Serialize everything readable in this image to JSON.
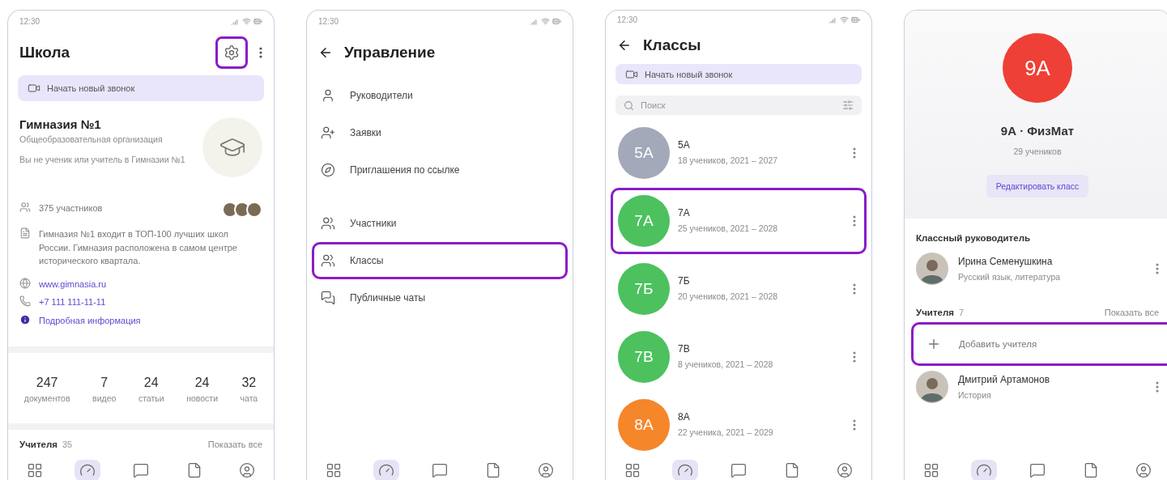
{
  "screens": [
    {
      "kind": "school",
      "status_time": "12:30",
      "title": "Школа",
      "settings_highlighted": true,
      "banner": "Начать новый звонок",
      "org": {
        "name": "Гимназия №1",
        "type": "Общеобразовательная организация",
        "note": "Вы не ученик или учитель в Гимназии №1"
      },
      "members": "375 участников",
      "description": "Гимназия №1 входит в ТОП-100 лучших школ России. Гимназия расположена в самом центре исторического квартала.",
      "website": "www.gimnasia.ru",
      "phone": "+7 111 111-11-11",
      "more": "Подробная информация",
      "stats": [
        {
          "value": "247",
          "label": "документов"
        },
        {
          "value": "7",
          "label": "видео"
        },
        {
          "value": "24",
          "label": "статьи"
        },
        {
          "value": "24",
          "label": "новости"
        },
        {
          "value": "32",
          "label": "чата"
        }
      ],
      "teachers": {
        "title": "Учителя",
        "count": "35",
        "action": "Показать все"
      },
      "nav": [
        {
          "selected": false
        },
        {
          "selected": true
        },
        {
          "selected": false
        },
        {
          "selected": false
        },
        {
          "selected": false
        }
      ]
    },
    {
      "kind": "menu",
      "status_time": "12:30",
      "title": "Управление",
      "groups": [
        [
          {
            "label": "Руководители",
            "highlighted": false
          },
          {
            "label": "Заявки",
            "highlighted": false
          },
          {
            "label": "Приглашения по ссылке",
            "highlighted": false
          }
        ],
        [
          {
            "label": "Участники",
            "highlighted": false
          },
          {
            "label": "Классы",
            "highlighted": true
          },
          {
            "label": "Публичные чаты",
            "highlighted": false
          }
        ]
      ],
      "nav": [
        {
          "selected": false
        },
        {
          "selected": true
        },
        {
          "selected": false
        },
        {
          "selected": false
        },
        {
          "selected": false
        }
      ]
    },
    {
      "kind": "classes",
      "status_time": "12:30",
      "title": "Классы",
      "banner": "Начать новый звонок",
      "search": {
        "placeholder": "Поиск"
      },
      "classes": [
        {
          "badge": "5А",
          "name": "5А",
          "info": "18 учеников, 2021 – 2027",
          "color": "#a3a9b8",
          "highlighted": false
        },
        {
          "badge": "7А",
          "name": "7А",
          "info": "25 учеников, 2021 – 2028",
          "color": "#4cc15e",
          "highlighted": true
        },
        {
          "badge": "7Б",
          "name": "7Б",
          "info": "20 учеников, 2021 – 2028",
          "color": "#4cc15e",
          "highlighted": false
        },
        {
          "badge": "7В",
          "name": "7В",
          "info": "8 учеников, 2021 – 2028",
          "color": "#4cc15e",
          "highlighted": false
        },
        {
          "badge": "8А",
          "name": "8А",
          "info": "22 ученика, 2021 – 2029",
          "color": "#f5862a",
          "highlighted": false
        }
      ],
      "nav": [
        {
          "selected": false
        },
        {
          "selected": true
        },
        {
          "selected": false
        },
        {
          "selected": false
        },
        {
          "selected": false
        }
      ]
    },
    {
      "kind": "class",
      "badge": {
        "text": "9А",
        "color": "#ee4036"
      },
      "title": "9А · ФизМат",
      "subtitle": "29 учеников",
      "edit": "Редактировать класс",
      "head_title": "Классный руководитель",
      "head": {
        "name": "Ирина Семенушкина",
        "subject": "Русский язык, литература"
      },
      "teachers": {
        "title": "Учителя",
        "count": "7",
        "action": "Показать все"
      },
      "add": {
        "label": "Добавить учителя",
        "highlighted": true
      },
      "people": [
        {
          "name": "Дмитрий Артамонов",
          "subject": "История"
        }
      ],
      "nav": [
        {
          "selected": false
        },
        {
          "selected": true
        },
        {
          "selected": false
        },
        {
          "selected": false
        },
        {
          "selected": false
        }
      ]
    }
  ]
}
